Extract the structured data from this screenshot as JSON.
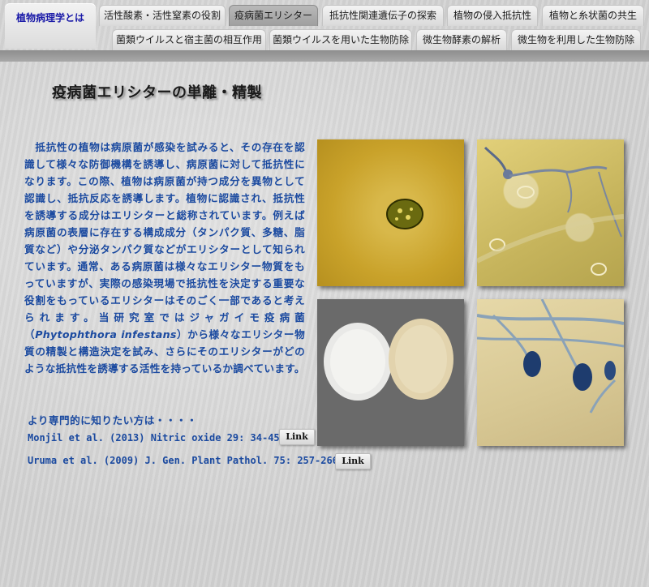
{
  "nav": {
    "home_label": "植物病理学とは",
    "row1": [
      "活性酸素・活性窒素の役割",
      "疫病菌エリシター",
      "抵抗性関連遺伝子の探索",
      "植物の侵入抵抗性",
      "植物と糸状菌の共生"
    ],
    "row2": [
      "菌類ウイルスと宿主菌の相互作用",
      "菌類ウイルスを用いた生物防除",
      "微生物酵素の解析",
      "微生物を利用した生物防除"
    ],
    "active_tab": "疫病菌エリシター"
  },
  "page": {
    "title": "疫病菌エリシターの単離・精製",
    "paragraph_part1": "　抵抗性の植物は病原菌が感染を試みると、その存在を認識して様々な防御機構を誘導し、病原菌に対して抵抗性になります。この際、植物は病原菌が持つ成分を異物として認識し、抵抗反応を誘導します。植物に認識され、抵抗性を誘導する成分はエリシターと総称されています。例えば病原菌の表層に存在する構成成分（タンパク質、多糖、脂質など）や分泌タンパク質などがエリシターとして知られています。通常、ある病原菌は様々なエリシター物質をもっていますが、実際の感染現場で抵抗性を決定する重要な役割をもっているエリシターはそのごく一部であると考えられます。当研究室ではジャガイモ疫病菌（",
    "species_italic": "Phytophthora infestans",
    "paragraph_part2": "）から様々なエリシター物質の精製と構造決定を試み、さらにそのエリシターがどのような抵抗性を誘導する活性を持っているか調べています。"
  },
  "references": {
    "heading": "より専門的に知りたい方は・・・・",
    "items": [
      {
        "text": "Monjil et al. (2013) Nitric oxide 29: 34-45.",
        "link_label": "Link"
      },
      {
        "text": "Uruma et al. (2009) J. Gen. Plant Pathol. 75: 257-266.",
        "link_label": "Link"
      }
    ]
  },
  "colors": {
    "body_text": "#1b4aa0",
    "home_tab_text": "#1a1aa8",
    "active_tab": "#a8a8a8",
    "band": "#9a9a9a"
  },
  "photos": [
    "spore-micrograph-icon",
    "germinating-hyphae-micrograph-icon",
    "colonies-petri-icon",
    "sporangia-stained-icon"
  ]
}
